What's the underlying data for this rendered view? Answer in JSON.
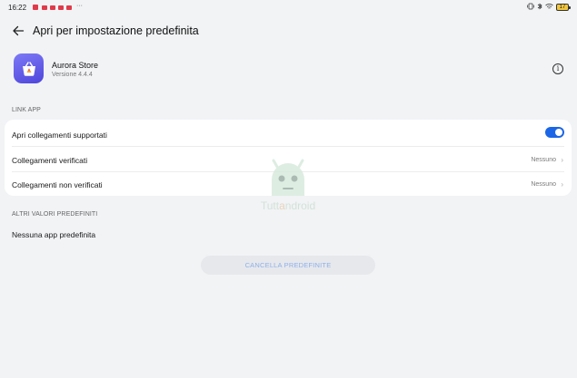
{
  "status_bar": {
    "time": "16:22",
    "more_dots": "···",
    "battery": "17"
  },
  "header": {
    "title": "Apri per impostazione predefinita"
  },
  "app": {
    "name": "Aurora Store",
    "version": "Versione 4.4.4"
  },
  "link_app": {
    "section_title": "LINK APP",
    "rows": [
      {
        "label": "Apri collegamenti supportati",
        "toggle_on": true
      },
      {
        "label": "Collegamenti verificati",
        "value": "Nessuno"
      },
      {
        "label": "Collegamenti non verificati",
        "value": "Nessuno"
      }
    ]
  },
  "other_defaults": {
    "section_title": "ALTRI VALORI PREDEFINITI",
    "message": "Nessuna app predefinita"
  },
  "clear_button": {
    "label": "CANCELLA PREDEFINITE"
  },
  "watermark": {
    "text_left": "Tutt",
    "text_highlight": "a",
    "text_right": "ndroid"
  },
  "colors": {
    "accent": "#1b66e6",
    "background": "#f1f3f5",
    "app_icon": "#5a52e4"
  }
}
